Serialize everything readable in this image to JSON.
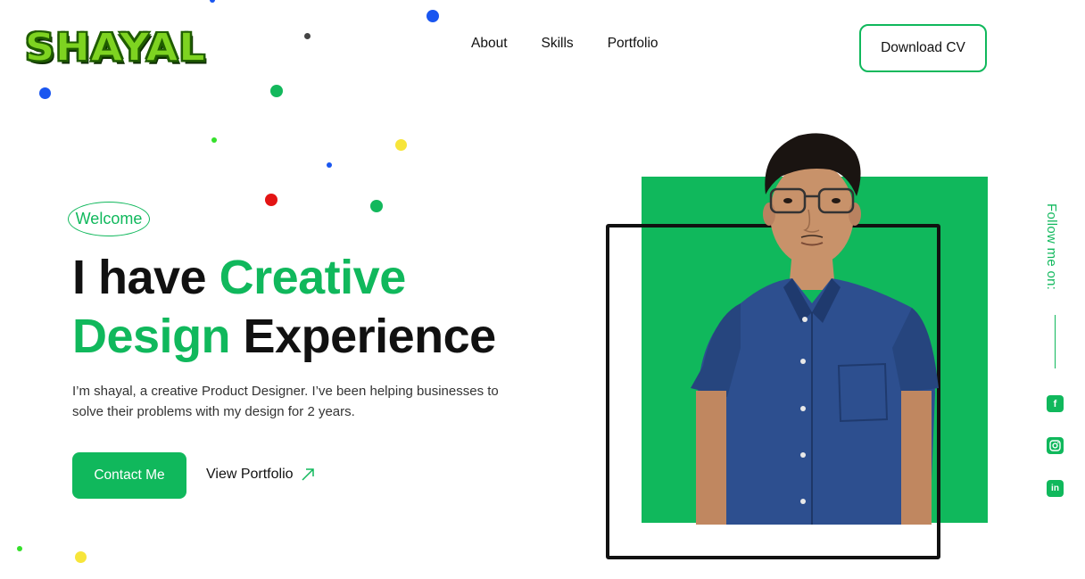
{
  "brand": {
    "logo_text": "SHAYAL"
  },
  "nav": {
    "items": [
      "About",
      "Skills",
      "Portfolio"
    ],
    "download_cv": "Download CV"
  },
  "hero": {
    "badge": "Welcome",
    "headline_part1": "I have ",
    "headline_green1": "Creative",
    "headline_green2": "Design",
    "headline_part2": " Experience",
    "description": "I’m shayal, a creative Product Designer. I’ve been helping businesses to solve their problems with my design for 2 years.",
    "contact_button": "Contact Me",
    "portfolio_link": "View Portfolio"
  },
  "sidebar": {
    "follow_label": "Follow me on:",
    "socials": [
      "facebook-icon",
      "instagram-icon",
      "linkedin-icon"
    ]
  },
  "colors": {
    "accent": "#10b85c",
    "text": "#111111",
    "logo": "#7ed321"
  }
}
